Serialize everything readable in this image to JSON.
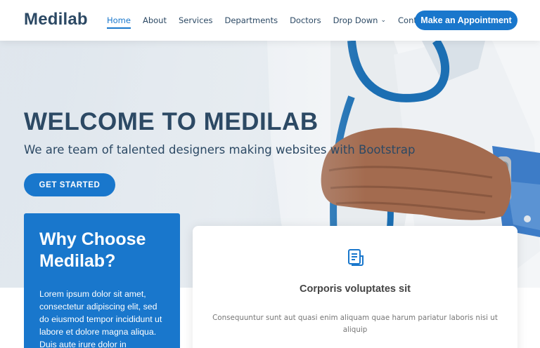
{
  "header": {
    "logo": "Medilab",
    "nav": [
      {
        "label": "Home",
        "active": true
      },
      {
        "label": "About"
      },
      {
        "label": "Services"
      },
      {
        "label": "Departments"
      },
      {
        "label": "Doctors"
      },
      {
        "label": "Drop Down",
        "dropdown": true
      },
      {
        "label": "Contact"
      }
    ],
    "appointment_button": "Make an Appointment"
  },
  "hero": {
    "title": "WELCOME TO MEDILAB",
    "subtitle": "We are team of talented designers making websites with Bootstrap",
    "cta": "GET STARTED"
  },
  "why": {
    "title": "Why Choose Medilab?",
    "text": "Lorem ipsum dolor sit amet, consectetur adipiscing elit, sed do eiusmod tempor incididunt ut labore et dolore magna aliqua. Duis aute irure dolor in"
  },
  "card": {
    "icon": "document-list-icon",
    "title": "Corporis voluptates sit",
    "text": "Consequuntur sunt aut quasi enim aliquam quae harum pariatur laboris nisi ut aliquip"
  },
  "colors": {
    "primary": "#1977cc",
    "heading": "#2c4964",
    "body_text": "#777777"
  }
}
